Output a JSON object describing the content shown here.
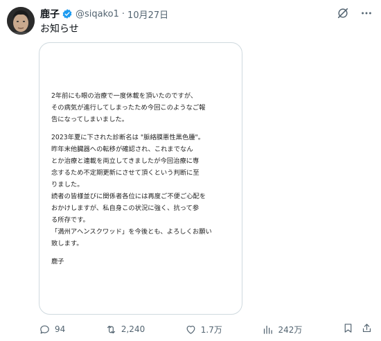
{
  "author": {
    "display_name": "鹿子",
    "handle": "@siqako1",
    "separator": "·",
    "date": "10月27日"
  },
  "post": {
    "text": "お知らせ"
  },
  "notice": {
    "paragraphs": [
      [
        "2年前にも眼の治療で一度休載を頂いたのですが、",
        "その病気が進行してしまったため今回このようなご報",
        "告になってしまいました。"
      ],
      [
        "2023年夏に下された診断名は \"脈絡膜悪性黒色腫\"。",
        "昨年末他臓器への転移が確認され、これまでなん",
        "とか治療と連載を両立してきましたが今回治療に専",
        "念するため不定期更新にさせて頂くという判断に至",
        "りました。",
        "読者の皆様並びに関係者各位には再度ご不便ご心配を",
        "おかけしますが、私自身この状況に強く、抗って参",
        "る所存です。",
        "「満州アヘンスクワッド」を今後とも、よろしくお願い",
        "致します。"
      ],
      [
        "鹿子"
      ]
    ]
  },
  "actions": {
    "replies": "94",
    "reposts": "2,240",
    "likes": "1.7万",
    "views": "242万"
  },
  "icons": {
    "verified": "verified-badge-icon",
    "grok": "grok-icon",
    "more": "more-icon",
    "reply": "reply-icon",
    "repost": "repost-icon",
    "like": "like-icon",
    "views": "views-icon",
    "bookmark": "bookmark-icon",
    "share": "share-icon"
  },
  "colors": {
    "accent": "#1d9bf0",
    "text": "#0f1419",
    "secondary": "#536471",
    "border": "#cfd9de"
  }
}
